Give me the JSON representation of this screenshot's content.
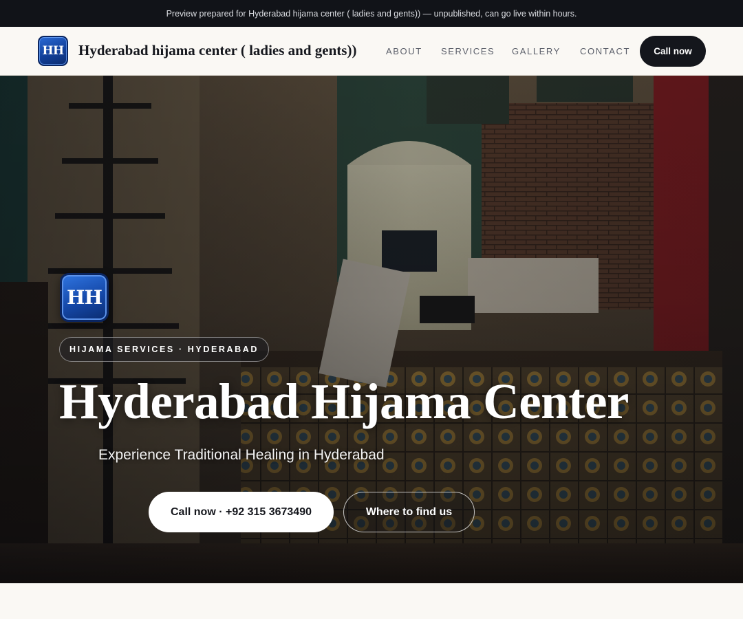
{
  "preview_banner": {
    "text": "Preview prepared for Hyderabad hijama center ( ladies and gents)) — unpublished, can go live within hours."
  },
  "header": {
    "logo_initials": "HH",
    "brand_name": "Hyderabad hijama center ( ladies and gents))",
    "nav": {
      "about": "ABOUT",
      "services": "SERVICES",
      "gallery": "GALLERY",
      "contact": "CONTACT"
    },
    "call_button": "Call now"
  },
  "hero": {
    "logo_initials": "HH",
    "eyebrow": "HIJAMA SERVICES · HYDERABAD",
    "title": "Hyderabad Hijama Center",
    "subtitle": "Experience Traditional Healing in Hyderabad",
    "primary_button": "Call now · +92 315 3673490",
    "secondary_button": "Where to find us"
  },
  "colors": {
    "banner_bg": "#111318",
    "page_bg": "#faf8f4",
    "dark_button": "#14161c",
    "logo_blue": "#1548a8"
  }
}
